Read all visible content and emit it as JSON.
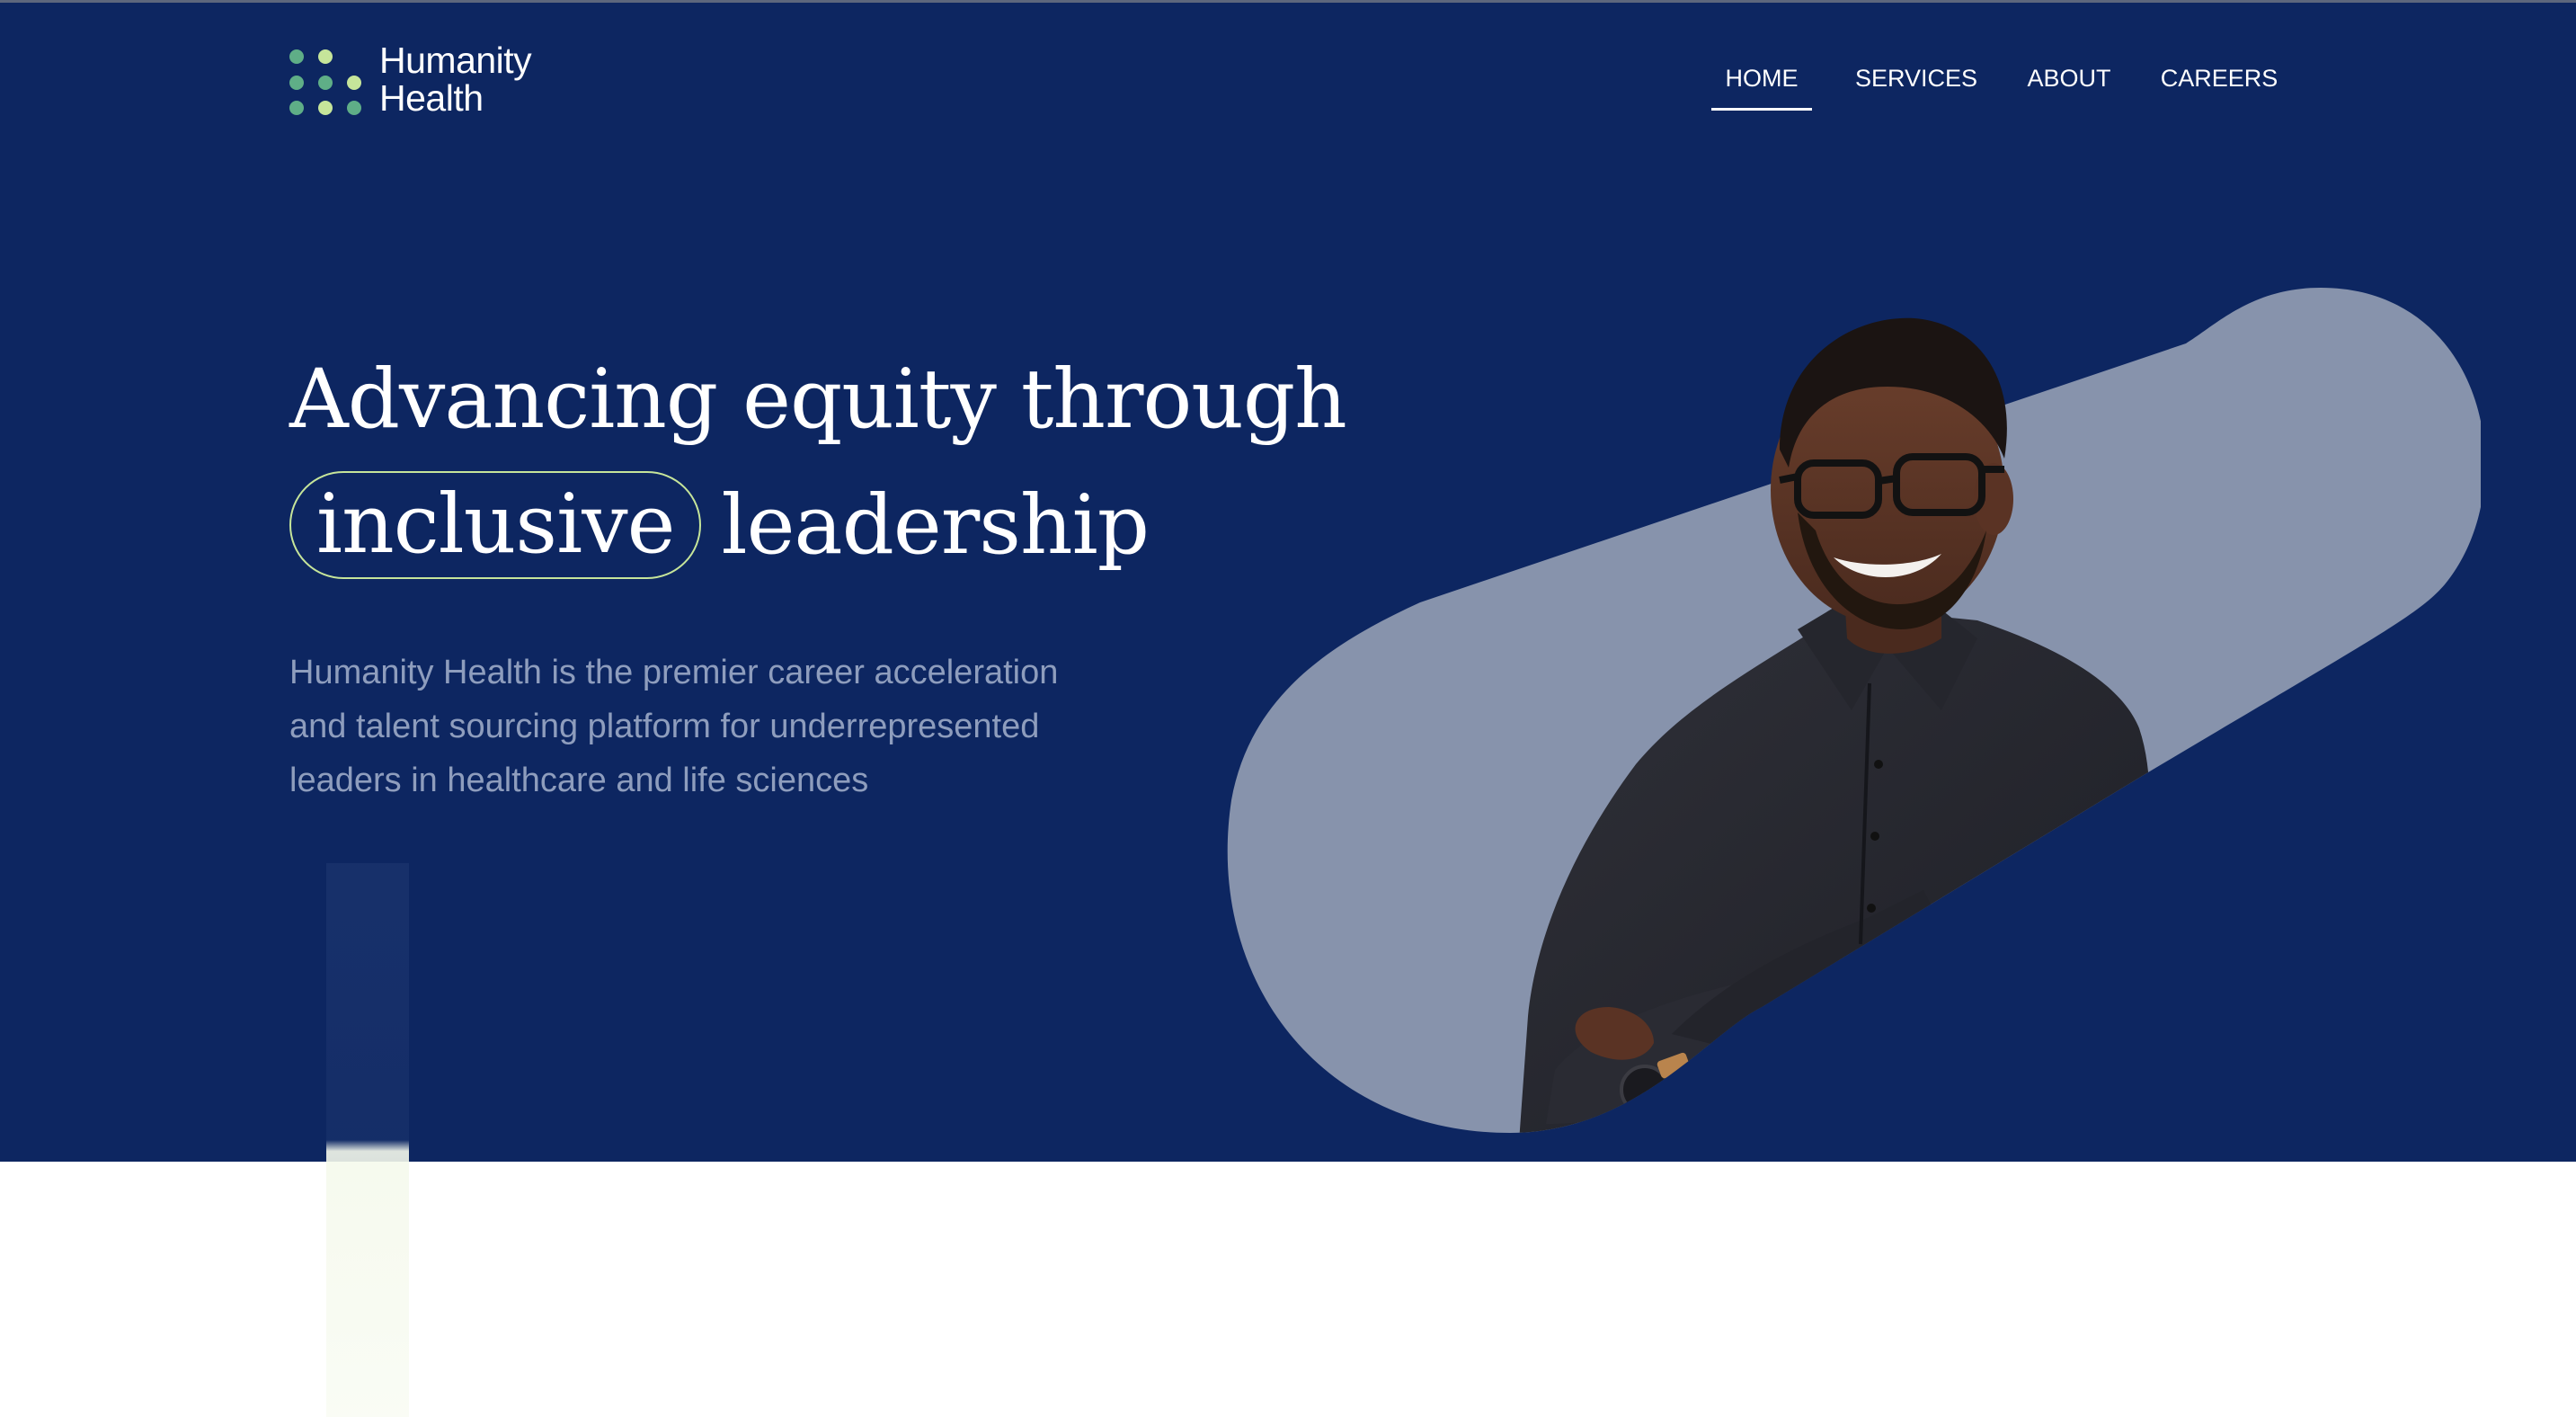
{
  "brand": {
    "name_line1": "Humanity",
    "name_line2": "Health",
    "colors": {
      "navy": "#0d2661",
      "green": "#7fd17a",
      "light_green": "#c6e59a",
      "slate": "#8793ac"
    }
  },
  "nav": {
    "items": [
      {
        "label": "HOME",
        "active": true
      },
      {
        "label": "SERVICES",
        "active": false
      },
      {
        "label": "ABOUT",
        "active": false
      },
      {
        "label": "CAREERS",
        "active": false
      }
    ]
  },
  "hero": {
    "headline_line1": "Advancing equity through",
    "headline_highlight": "inclusive",
    "headline_rest": "leadership",
    "description": "Humanity Health is the premier career acceleration and talent sourcing platform for underrepresented leaders in healthcare and life sciences",
    "image": "smiling-man-in-glasses-arms-crossed"
  }
}
